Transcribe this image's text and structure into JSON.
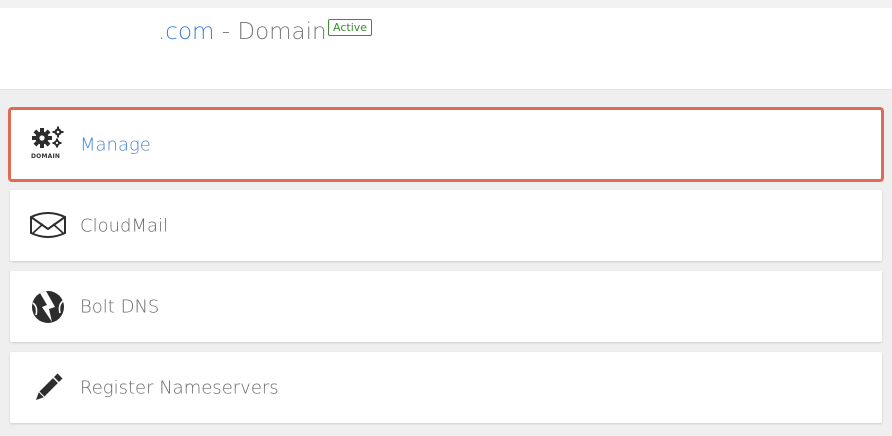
{
  "header": {
    "domain_ext": ".com",
    "separator_title": " - Domain",
    "status_badge": "Active"
  },
  "menu": {
    "items": [
      {
        "label": "Manage",
        "icon": "gears-domain-icon",
        "icon_caption": "DOMAIN",
        "selected": true
      },
      {
        "label": "CloudMail",
        "icon": "envelope-icon",
        "selected": false
      },
      {
        "label": "Bolt DNS",
        "icon": "bolt-dns-icon",
        "selected": false
      },
      {
        "label": "Register Nameservers",
        "icon": "pencil-icon",
        "selected": false
      }
    ]
  },
  "colors": {
    "accent_link": "#4a86d8",
    "selected_outline": "#e06a52",
    "badge_green": "#3c8d2f"
  }
}
